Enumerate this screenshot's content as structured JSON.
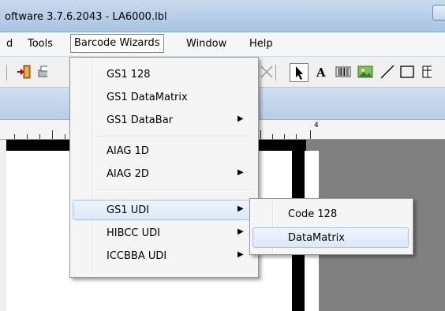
{
  "window": {
    "title": "oftware 3.7.6.2043 - LA6000.lbl"
  },
  "menubar": {
    "items": [
      "d",
      "Tools",
      "Barcode Wizards",
      "Window",
      "Help"
    ]
  },
  "barcode_wizards_menu": {
    "items": [
      {
        "label": "GS1 128",
        "submenu": false
      },
      {
        "label": "GS1 DataMatrix",
        "submenu": false
      },
      {
        "label": "GS1 DataBar",
        "submenu": true
      },
      {
        "label": "AIAG 1D",
        "submenu": false
      },
      {
        "label": "AIAG 2D",
        "submenu": true
      },
      {
        "label": "GS1 UDI",
        "submenu": true,
        "highlighted": true
      },
      {
        "label": "HIBCC UDI",
        "submenu": true
      },
      {
        "label": "ICCBBA UDI",
        "submenu": true
      }
    ],
    "arrow": "▶"
  },
  "gs1_udi_submenu": {
    "items": [
      {
        "label": "Code 128"
      },
      {
        "label": "DataMatrix",
        "highlighted": true
      }
    ]
  },
  "ruler": {
    "number": "4"
  },
  "toolbar": {
    "icons": [
      "import-icon",
      "print-icon",
      "delete-icon",
      "pointer-icon",
      "text-icon",
      "barcode-icon",
      "image-icon",
      "line-icon",
      "rectangle-icon"
    ]
  }
}
